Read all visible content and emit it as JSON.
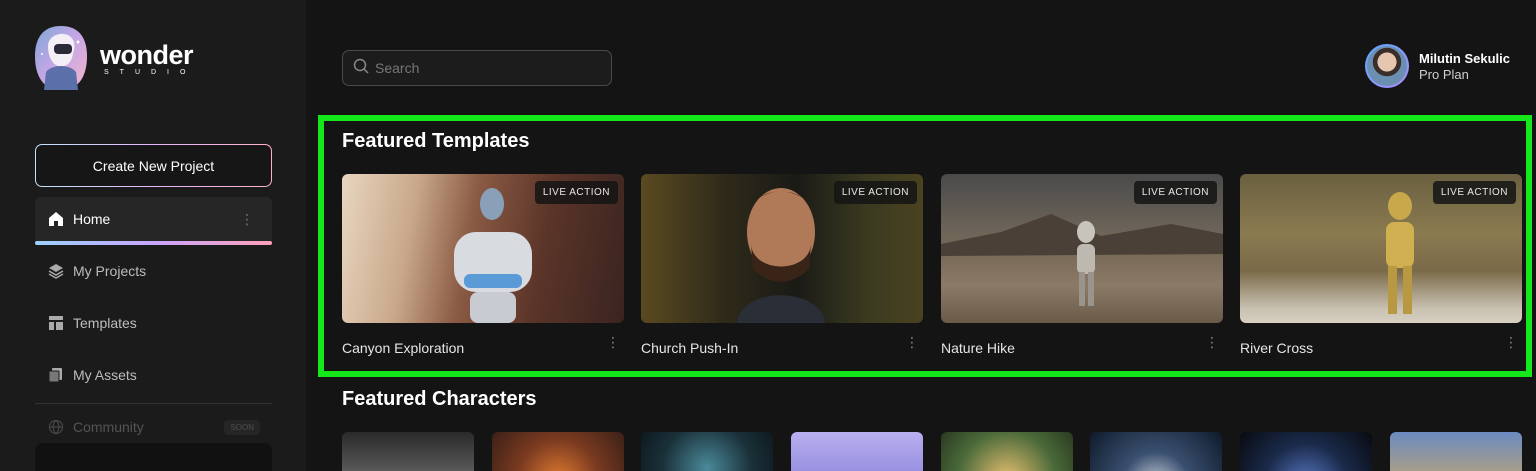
{
  "brand": {
    "name": "wonder",
    "sub": "STUDIO"
  },
  "sidebar": {
    "create_label": "Create New Project",
    "items": [
      {
        "label": "Home",
        "icon": "home-icon",
        "active": true
      },
      {
        "label": "My Projects",
        "icon": "layers-icon"
      },
      {
        "label": "Templates",
        "icon": "template-icon"
      },
      {
        "label": "My Assets",
        "icon": "assets-icon"
      },
      {
        "label": "Community",
        "icon": "globe-icon",
        "badge": "SOON"
      }
    ]
  },
  "search": {
    "placeholder": "Search"
  },
  "user": {
    "name": "Milutin Sekulic",
    "plan": "Pro Plan"
  },
  "featured_templates": {
    "title": "Featured Templates",
    "cards": [
      {
        "title": "Canyon Exploration",
        "badge": "LIVE ACTION"
      },
      {
        "title": "Church Push-In",
        "badge": "LIVE ACTION"
      },
      {
        "title": "Nature Hike",
        "badge": "LIVE ACTION"
      },
      {
        "title": "River Cross",
        "badge": "LIVE ACTION"
      }
    ]
  },
  "featured_characters": {
    "title": "Featured Characters"
  },
  "colors": {
    "highlight": "#14e81b",
    "background": "#141414",
    "sidebar": "#1b1b1b"
  }
}
